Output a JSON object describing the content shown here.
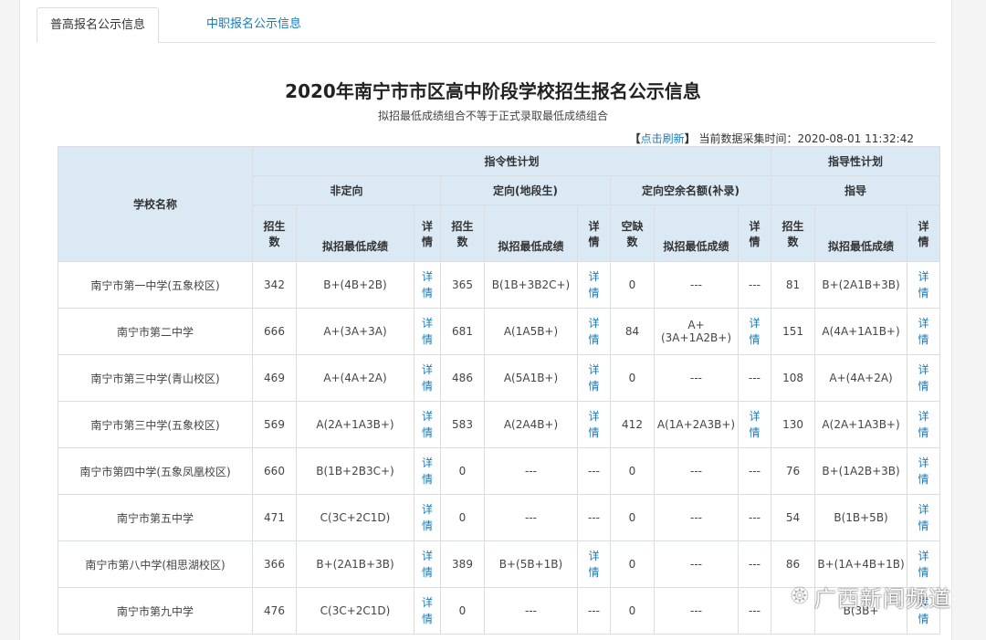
{
  "tabs": [
    {
      "label": "普高报名公示信息",
      "active": true
    },
    {
      "label": "中职报名公示信息",
      "active": false
    }
  ],
  "title": "2020年南宁市市区高中阶段学校招生报名公示信息",
  "subtitle": "拟招最低成绩组合不等于正式录取最低成绩组合",
  "refresh": {
    "bracket_open": "【",
    "link": "点击刷新",
    "bracket_close": "】",
    "label": "当前数据采集时间：",
    "time": "2020-08-01 11:32:42"
  },
  "table": {
    "group_top": {
      "directive": "指令性计划",
      "guidance": "指导性计划"
    },
    "group_mid": {
      "non_directional": "非定向",
      "directional": "定向(地段生)",
      "vacancy": "定向空余名额(补录)",
      "guide": "指导"
    },
    "headers": {
      "school": "学校名称",
      "enroll": "招生数",
      "min_score": "拟招最低成绩",
      "detail": "详情",
      "vacancy_count": "空缺数"
    },
    "rows": [
      {
        "school": "南宁市第一中学(五象校区)",
        "n1": "342",
        "s1": "B+(4B+2B)",
        "d1": "详情",
        "n2": "365",
        "s2": "B(1B+3B2C+)",
        "d2": "详情",
        "n3": "0",
        "s3": "---",
        "d3": "---",
        "n4": "81",
        "s4": "B+(2A1B+3B)",
        "d4": "详情"
      },
      {
        "school": "南宁市第二中学",
        "n1": "666",
        "s1": "A+(3A+3A)",
        "d1": "详情",
        "n2": "681",
        "s2": "A(1A5B+)",
        "d2": "详情",
        "n3": "84",
        "s3": "A+(3A+1A2B+)",
        "d3": "详情",
        "n4": "151",
        "s4": "A(4A+1A1B+)",
        "d4": "详情"
      },
      {
        "school": "南宁市第三中学(青山校区)",
        "n1": "469",
        "s1": "A+(4A+2A)",
        "d1": "详情",
        "n2": "486",
        "s2": "A(5A1B+)",
        "d2": "详情",
        "n3": "0",
        "s3": "---",
        "d3": "---",
        "n4": "108",
        "s4": "A+(4A+2A)",
        "d4": "详情"
      },
      {
        "school": "南宁市第三中学(五象校区)",
        "n1": "569",
        "s1": "A(2A+1A3B+)",
        "d1": "详情",
        "n2": "583",
        "s2": "A(2A4B+)",
        "d2": "详情",
        "n3": "412",
        "s3": "A(1A+2A3B+)",
        "d3": "详情",
        "n4": "130",
        "s4": "A(2A+1A3B+)",
        "d4": "详情"
      },
      {
        "school": "南宁市第四中学(五象凤凰校区)",
        "n1": "660",
        "s1": "B(1B+2B3C+)",
        "d1": "详情",
        "n2": "0",
        "s2": "---",
        "d2": "---",
        "n3": "0",
        "s3": "---",
        "d3": "---",
        "n4": "76",
        "s4": "B+(1A2B+3B)",
        "d4": "详情"
      },
      {
        "school": "南宁市第五中学",
        "n1": "471",
        "s1": "C(3C+2C1D)",
        "d1": "详情",
        "n2": "0",
        "s2": "---",
        "d2": "---",
        "n3": "0",
        "s3": "---",
        "d3": "---",
        "n4": "54",
        "s4": "B(1B+5B)",
        "d4": "详情"
      },
      {
        "school": "南宁市第八中学(相思湖校区)",
        "n1": "366",
        "s1": "B+(2A1B+3B)",
        "d1": "详情",
        "n2": "389",
        "s2": "B+(5B+1B)",
        "d2": "详情",
        "n3": "0",
        "s3": "---",
        "d3": "---",
        "n4": "86",
        "s4": "B+(1A+4B+1B)",
        "d4": "详情"
      },
      {
        "school": "南宁市第九中学",
        "n1": "476",
        "s1": "C(3C+2C1D)",
        "d1": "详情",
        "n2": "0",
        "s2": "---",
        "d2": "---",
        "n3": "0",
        "s3": "---",
        "d3": "---",
        "n4": "",
        "s4": "B(3B+",
        "d4": "详情"
      }
    ]
  },
  "watermark": {
    "text": "广西新闻频道",
    "icon": "wechat-icon"
  },
  "colors": {
    "header_bg": "#dbe9f4",
    "link": "#1a7bb9",
    "border": "#d8dde3"
  }
}
